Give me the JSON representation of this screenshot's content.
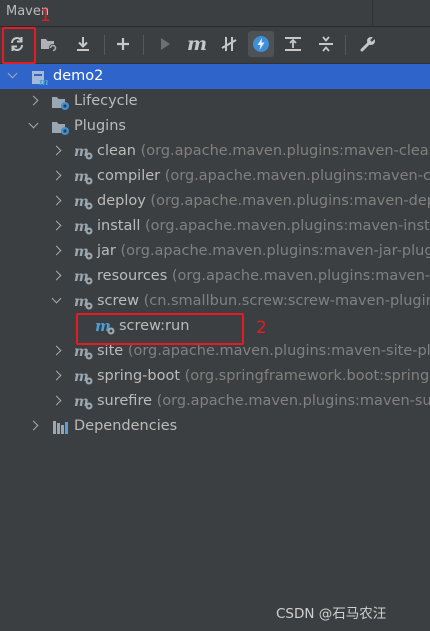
{
  "panel": {
    "title": "Maven"
  },
  "toolbar": {
    "icons": [
      "reload-icon",
      "add-project-icon",
      "download-icon",
      "plus-icon",
      "run-icon",
      "maven-goal-icon",
      "skip-tests-icon",
      "offline-icon",
      "show-dependencies-icon",
      "collapse-all-icon",
      "settings-wrench-icon"
    ]
  },
  "tree": {
    "project": "demo2",
    "lifecycle": "Lifecycle",
    "plugins": "Plugins",
    "dependencies": "Dependencies",
    "items": [
      {
        "name": "clean",
        "detail": "(org.apache.maven.plugins:maven-clean"
      },
      {
        "name": "compiler",
        "detail": "(org.apache.maven.plugins:maven-co"
      },
      {
        "name": "deploy",
        "detail": "(org.apache.maven.plugins:maven-dep"
      },
      {
        "name": "install",
        "detail": "(org.apache.maven.plugins:maven-insta"
      },
      {
        "name": "jar",
        "detail": "(org.apache.maven.plugins:maven-jar-plug"
      },
      {
        "name": "resources",
        "detail": "(org.apache.maven.plugins:maven-r"
      },
      {
        "name": "screw",
        "detail": "(cn.smallbun.screw:screw-maven-plugin"
      },
      {
        "name": "site",
        "detail": "(org.apache.maven.plugins:maven-site-plu"
      },
      {
        "name": "spring-boot",
        "detail": "(org.springframework.boot:spring"
      },
      {
        "name": "surefire",
        "detail": "(org.apache.maven.plugins:maven-sur"
      }
    ],
    "goal": "screw:run"
  },
  "annotations": {
    "one": "1",
    "two": "2"
  },
  "watermark": "CSDN @石马农汪",
  "colors": {
    "background": "#3c3f41",
    "selection": "#2f65ca",
    "annotation": "#e51c23",
    "maven_icon": "#4a9fd8"
  }
}
